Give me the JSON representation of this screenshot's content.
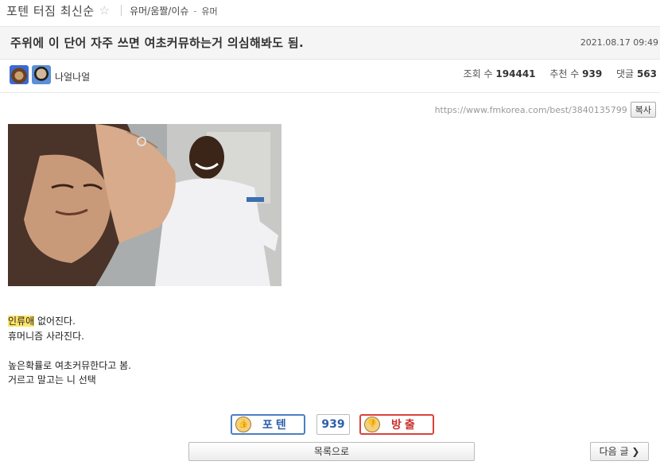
{
  "board": {
    "title": "포텐 터짐 최신순",
    "star_icon": "☆",
    "breadcrumb_main": "유머/움짤/이슈",
    "breadcrumb_dash": "-",
    "breadcrumb_sub": "유머"
  },
  "post": {
    "title": "주위에 이 단어 자주 쓰면 여초커뮤하는거 의심해봐도 됨.",
    "date": "2021.08.17 09:49",
    "author": "나얼나얼",
    "stats": {
      "views_label": "조회 수",
      "views": "194441",
      "recommend_label": "추천 수",
      "recommend": "939",
      "comments_label": "댓글",
      "comments": "563"
    },
    "url": "https://www.fmkorea.com/best/3840135799",
    "copy_label": "복사",
    "body": {
      "line1_highlight": "인류애",
      "line1_rest": " 없어진다.",
      "line2": "휴머니즘 사라진다.",
      "line3": "높은확률로 여초커뮤한다고 봄.",
      "line4": "거르고 말고는 니 선택"
    }
  },
  "votes": {
    "up_label": "포텐",
    "count": "939",
    "down_label": "방출"
  },
  "nav": {
    "list_label": "목록으로",
    "next_label": "다음 글",
    "next_icon": "chevron-right-icon"
  },
  "colors": {
    "accent_blue": "#2c5fa8",
    "accent_red": "#c9302c",
    "highlight": "#ffe46a"
  }
}
